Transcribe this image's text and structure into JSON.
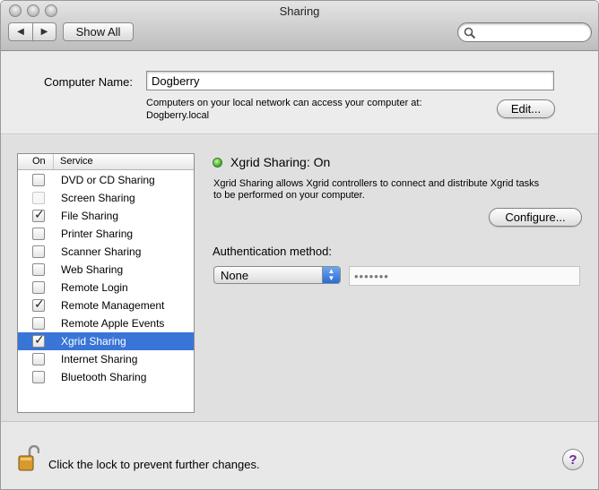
{
  "window": {
    "title": "Sharing"
  },
  "toolbar": {
    "back_icon": "◀",
    "forward_icon": "▶",
    "show_all_label": "Show All",
    "search_placeholder": "",
    "search_value": ""
  },
  "computer_name": {
    "label": "Computer Name:",
    "value": "Dogberry",
    "description_line1": "Computers on your local network can access your computer at:",
    "description_line2": "Dogberry.local",
    "edit_button": "Edit..."
  },
  "services": {
    "header_on": "On",
    "header_service": "Service",
    "items": [
      {
        "label": "DVD or CD Sharing",
        "checked": false,
        "dim": false,
        "selected": false
      },
      {
        "label": "Screen Sharing",
        "checked": false,
        "dim": true,
        "selected": false
      },
      {
        "label": "File Sharing",
        "checked": true,
        "dim": false,
        "selected": false
      },
      {
        "label": "Printer Sharing",
        "checked": false,
        "dim": false,
        "selected": false
      },
      {
        "label": "Scanner Sharing",
        "checked": false,
        "dim": false,
        "selected": false
      },
      {
        "label": "Web Sharing",
        "checked": false,
        "dim": false,
        "selected": false
      },
      {
        "label": "Remote Login",
        "checked": false,
        "dim": false,
        "selected": false
      },
      {
        "label": "Remote Management",
        "checked": true,
        "dim": false,
        "selected": false
      },
      {
        "label": "Remote Apple Events",
        "checked": false,
        "dim": false,
        "selected": false
      },
      {
        "label": "Xgrid Sharing",
        "checked": true,
        "dim": false,
        "selected": true
      },
      {
        "label": "Internet Sharing",
        "checked": false,
        "dim": false,
        "selected": false
      },
      {
        "label": "Bluetooth Sharing",
        "checked": false,
        "dim": false,
        "selected": false
      }
    ]
  },
  "detail": {
    "status_title": "Xgrid Sharing: On",
    "status_color": "#3fae2a",
    "description_line1": "Xgrid Sharing allows Xgrid controllers to connect and distribute Xgrid tasks",
    "description_line2": "to be performed on your computer.",
    "configure_button": "Configure...",
    "auth_label": "Authentication method:",
    "auth_selected": "None",
    "password_mask": "•••••••"
  },
  "footer": {
    "lock_text": "Click the lock to prevent further changes.",
    "help_label": "?"
  },
  "colors": {
    "selection": "#3875d7",
    "help_glyph": "#6a2a9e"
  }
}
